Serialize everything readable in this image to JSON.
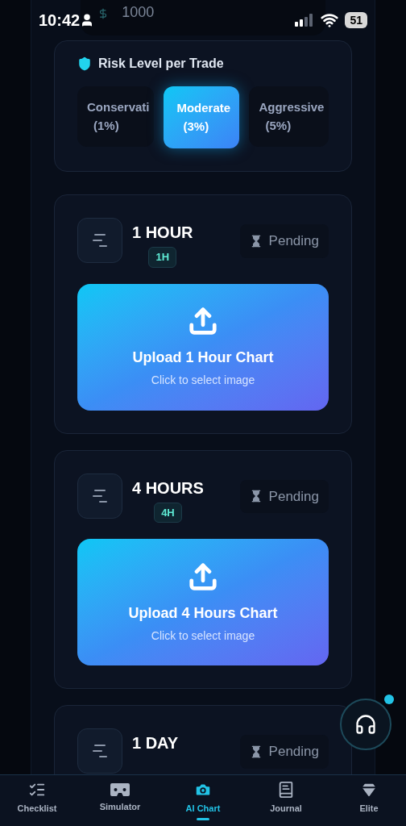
{
  "status_bar": {
    "time": "10:42",
    "balance": "1000",
    "battery": "51"
  },
  "risk": {
    "title": "Risk Level per Trade",
    "options": [
      {
        "label": "Conservati",
        "percent": "(1%)",
        "selected": false
      },
      {
        "label": "Moderate",
        "percent": "(3%)",
        "selected": true
      },
      {
        "label": "Aggressive",
        "percent": "(5%)",
        "selected": false
      }
    ]
  },
  "timeframes": [
    {
      "title": "1 HOUR",
      "badge": "1H",
      "status": "Pending",
      "upload_title": "Upload 1 Hour Chart",
      "upload_hint": "Click to select image"
    },
    {
      "title": "4 HOURS",
      "badge": "4H",
      "status": "Pending",
      "upload_title": "Upload 4 Hours Chart",
      "upload_hint": "Click to select image"
    },
    {
      "title": "1 DAY",
      "status": "Pending"
    }
  ],
  "nav": [
    {
      "label": "Checklist",
      "kind": "checklist",
      "selected": false
    },
    {
      "label": "Simulator",
      "kind": "simulator",
      "selected": false
    },
    {
      "label": "AI Chart",
      "kind": "camera",
      "selected": true
    },
    {
      "label": "Journal",
      "kind": "journal",
      "selected": false
    },
    {
      "label": "Elite",
      "kind": "elite",
      "selected": false
    }
  ],
  "support": {
    "unread": true
  }
}
